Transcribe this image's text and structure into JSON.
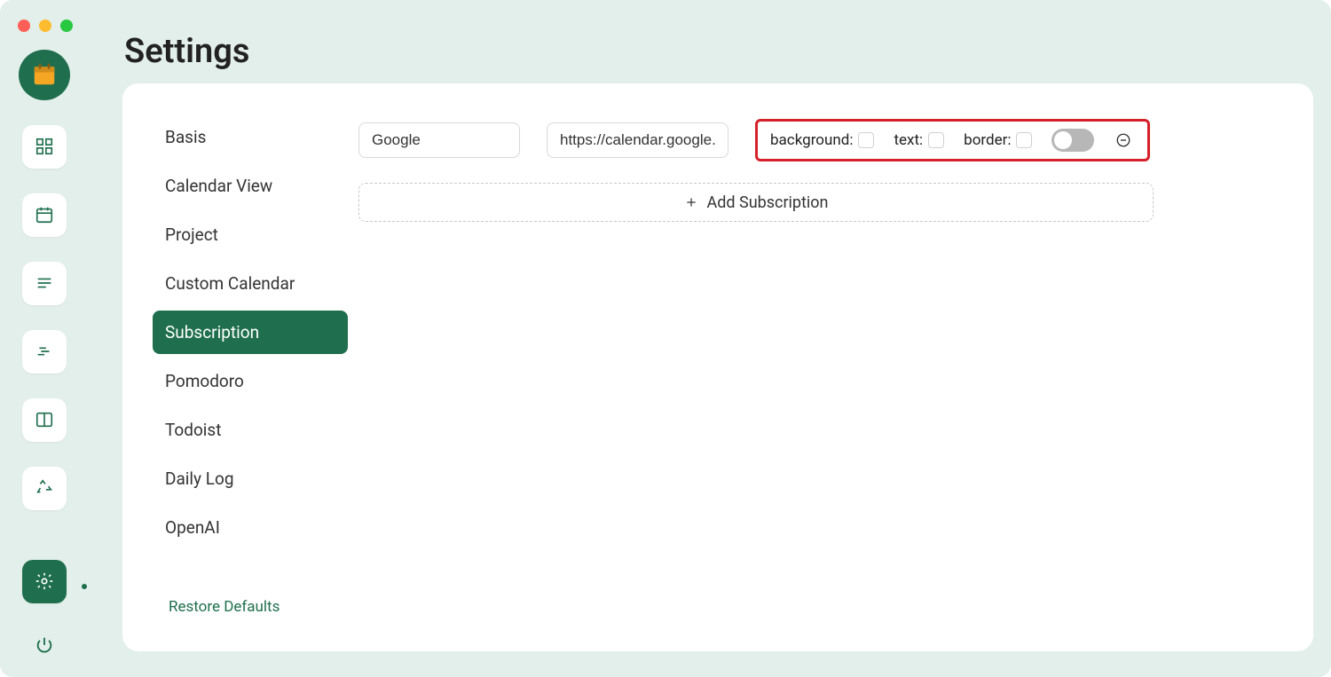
{
  "page": {
    "title": "Settings"
  },
  "settings_nav": {
    "items": [
      {
        "label": "Basis"
      },
      {
        "label": "Calendar View"
      },
      {
        "label": "Project"
      },
      {
        "label": "Custom Calendar"
      },
      {
        "label": "Subscription"
      },
      {
        "label": "Pomodoro"
      },
      {
        "label": "Todoist"
      },
      {
        "label": "Daily Log"
      },
      {
        "label": "OpenAI"
      }
    ],
    "selected_index": 4,
    "restore_label": "Restore Defaults"
  },
  "subscription": {
    "rows": [
      {
        "name_value": "Google",
        "url_value": "https://calendar.google.c",
        "background_label": "background:",
        "text_label": "text:",
        "border_label": "border:",
        "toggle_on": false
      }
    ],
    "add_label": "Add Subscription"
  },
  "sidebar_icons": [
    "dashboard-icon",
    "calendar-icon",
    "list-icon",
    "gantt-icon",
    "split-icon",
    "recycle-icon"
  ]
}
